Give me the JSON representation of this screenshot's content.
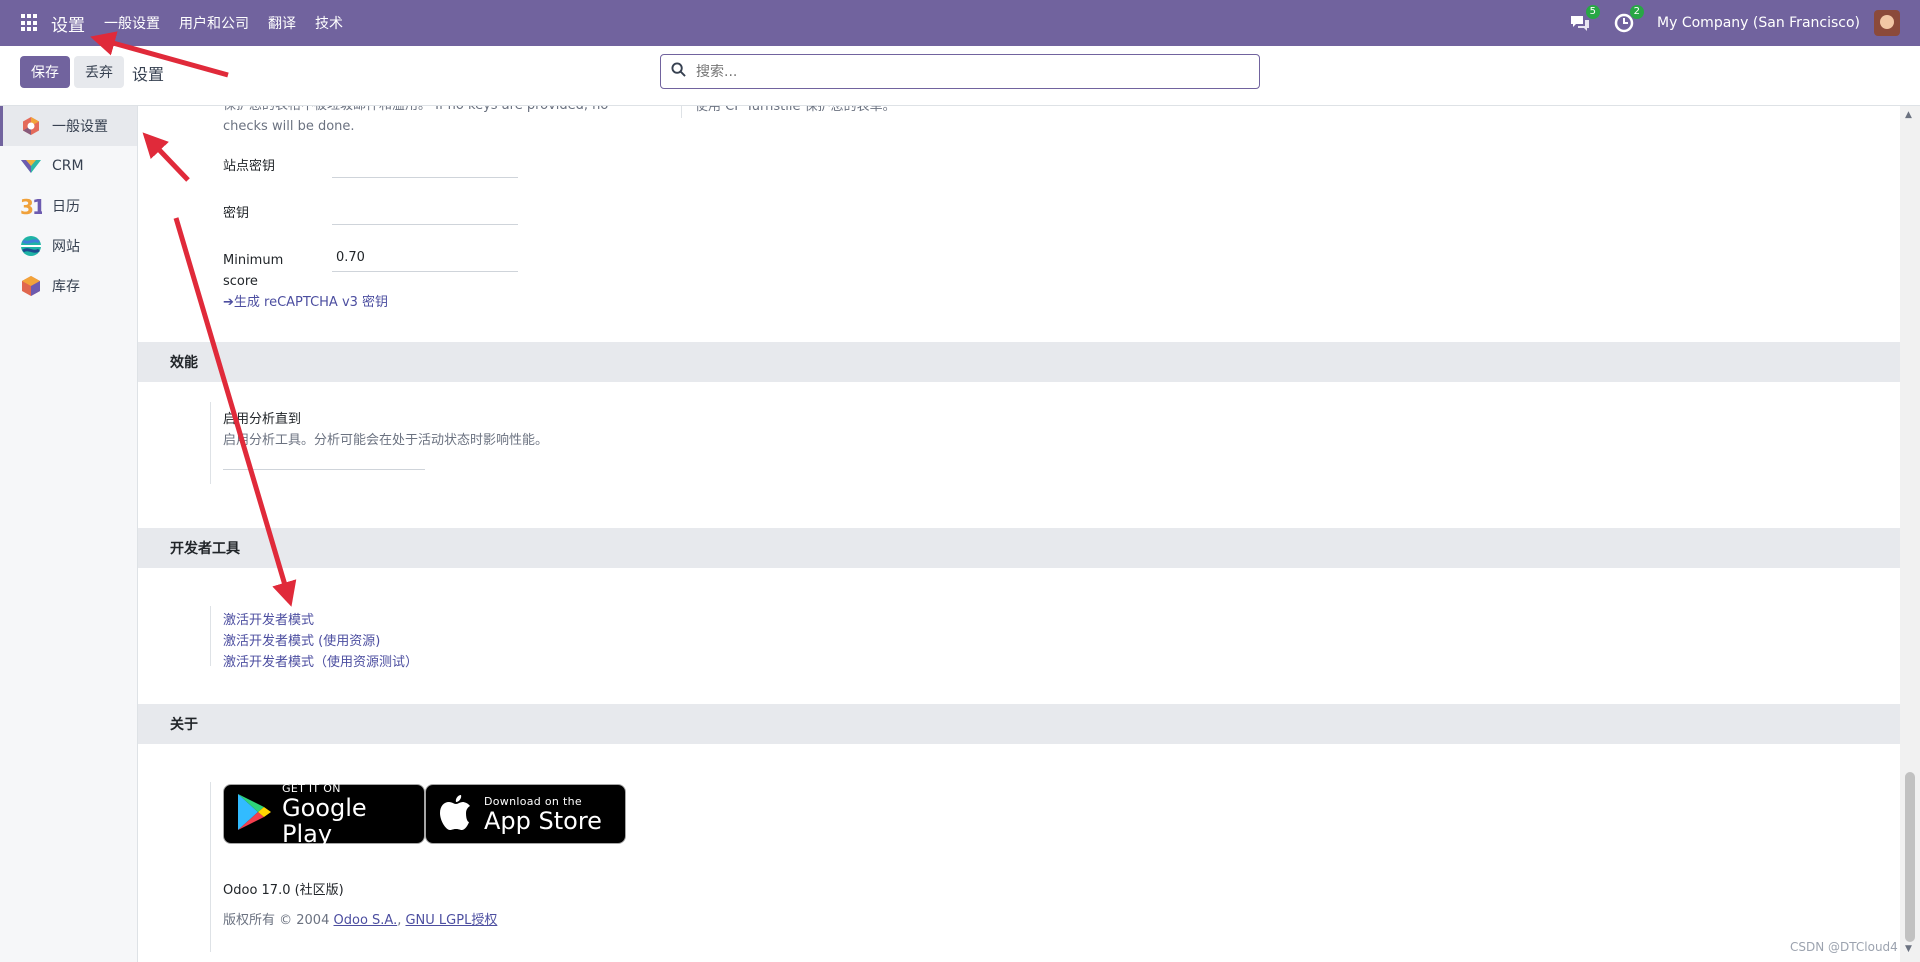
{
  "navbar": {
    "apps_icon": "grid-icon",
    "brand": "设置",
    "menu": [
      "一般设置",
      "用户和公司",
      "翻译",
      "技术"
    ],
    "chat_badge": "5",
    "activity_badge": "2",
    "company": "My Company (San Francisco)"
  },
  "control_panel": {
    "save_label": "保存",
    "discard_label": "丢弃",
    "title": "设置",
    "search_placeholder": "搜索..."
  },
  "sidebar": {
    "items": [
      {
        "label": "一般设置",
        "icon": "settings-app-icon",
        "active": true
      },
      {
        "label": "CRM",
        "icon": "crm-app-icon"
      },
      {
        "label": "日历",
        "icon": "calendar-app-icon"
      },
      {
        "label": "网站",
        "icon": "website-app-icon"
      },
      {
        "label": "库存",
        "icon": "inventory-app-icon"
      }
    ]
  },
  "recaptcha": {
    "desc_line1": "保护您的表格不被垃圾邮件和滥用。 If no keys are provided, no",
    "desc_line2": "checks will be done.",
    "right_desc": "使用 CF Turnstile 保护您的表单。",
    "site_key_label": "站点密钥",
    "site_key_value": "",
    "secret_label": "密钥",
    "secret_value": "",
    "min_score_label_1": "Minimum",
    "min_score_label_2": "score",
    "min_score_value": "0.70",
    "generate_link": "➔生成 reCAPTCHA v3 密钥"
  },
  "performance": {
    "header": "效能",
    "title": "启用分析直到",
    "desc": "启用分析工具。分析可能会在处于活动状态时影响性能。",
    "value": ""
  },
  "developer": {
    "header": "开发者工具",
    "links": [
      "激活开发者模式",
      "激活开发者模式 (使用资源)",
      "激活开发者模式（使用资源测试）"
    ]
  },
  "about": {
    "header": "关于",
    "google_play_small": "GET IT ON",
    "google_play_big": "Google Play",
    "app_store_small": "Download on the",
    "app_store_big": "App Store",
    "version": "Odoo 17.0 (社区版)",
    "copyright_prefix": "版权所有 © 2004",
    "odoo_link": "Odoo S.A.",
    "license_link": "GNU LGPL授权"
  },
  "watermark": "CSDN @DTCloud4",
  "colors": {
    "brand": "#71639e",
    "annotation_arrow": "#e02a3a",
    "link": "#4c4ea0"
  }
}
